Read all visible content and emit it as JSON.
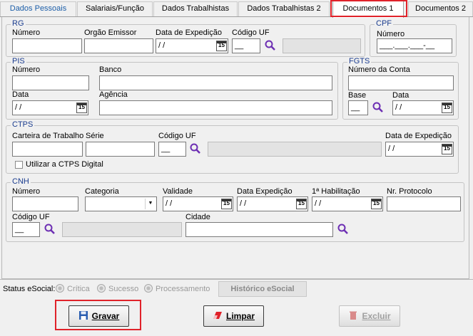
{
  "tabs": [
    {
      "label": "Dados Pessoais",
      "active": false
    },
    {
      "label": "Salariais/Função",
      "active": false
    },
    {
      "label": "Dados Trabalhistas",
      "active": false
    },
    {
      "label": "Dados Trabalhistas 2",
      "active": false
    },
    {
      "label": "Documentos 1",
      "active": true
    },
    {
      "label": "Documentos 2",
      "active": false
    }
  ],
  "rg": {
    "title": "RG",
    "numero_label": "Número",
    "numero_value": "",
    "orgao_label": "Orgão Emissor",
    "orgao_value": "",
    "data_expedicao_label": "Data de Expedição",
    "data_expedicao_value": "/ /",
    "codigo_uf_label": "Código UF",
    "codigo_uf_value": "__",
    "uf_name_value": ""
  },
  "cpf": {
    "title": "CPF",
    "numero_label": "Número",
    "numero_value": "___.___.___-__"
  },
  "pis": {
    "title": "PIS",
    "numero_label": "Número",
    "numero_value": "",
    "banco_label": "Banco",
    "banco_value": "",
    "data_label": "Data",
    "data_value": "/ /",
    "agencia_label": "Agência",
    "agencia_value": ""
  },
  "fgts": {
    "title": "FGTS",
    "numero_conta_label": "Número da Conta",
    "numero_conta_value": "",
    "base_label": "Base",
    "base_value": "__",
    "data_label": "Data",
    "data_value": "/ /"
  },
  "ctps": {
    "title": "CTPS",
    "carteira_label": "Carteira de Trabalho",
    "carteira_value": "",
    "serie_label": "Série",
    "serie_value": "",
    "codigo_uf_label": "Código UF",
    "codigo_uf_value": "__",
    "uf_name_value": "",
    "data_expedicao_label": "Data de Expedição",
    "data_expedicao_value": "/ /",
    "digital_label": "Utilizar a CTPS Digital",
    "digital_checked": false
  },
  "cnh": {
    "title": "CNH",
    "numero_label": "Número",
    "numero_value": "",
    "categoria_label": "Categoria",
    "categoria_value": "",
    "validade_label": "Validade",
    "validade_value": "/ /",
    "data_expedicao_label": "Data Expedição",
    "data_expedicao_value": "/ /",
    "primeira_habilitacao_label": "1ª Habilitação",
    "primeira_habilitacao_value": "/ /",
    "protocolo_label": "Nr. Protocolo",
    "protocolo_value": "",
    "codigo_uf_label": "Código UF",
    "codigo_uf_value": "__",
    "uf_name_value": "",
    "cidade_label": "Cidade",
    "cidade_value": ""
  },
  "esocial": {
    "status_label": "Status eSocial:",
    "options": [
      "Crítica",
      "Sucesso",
      "Processamento"
    ],
    "historico_label": "Histórico eSocial"
  },
  "actions": {
    "gravar": "Gravar",
    "limpar": "Limpar",
    "excluir": "Excluir"
  },
  "colors": {
    "accent": "#1b3d8f",
    "highlight": "#e0222a",
    "search_icon": "#6d2fb3"
  }
}
